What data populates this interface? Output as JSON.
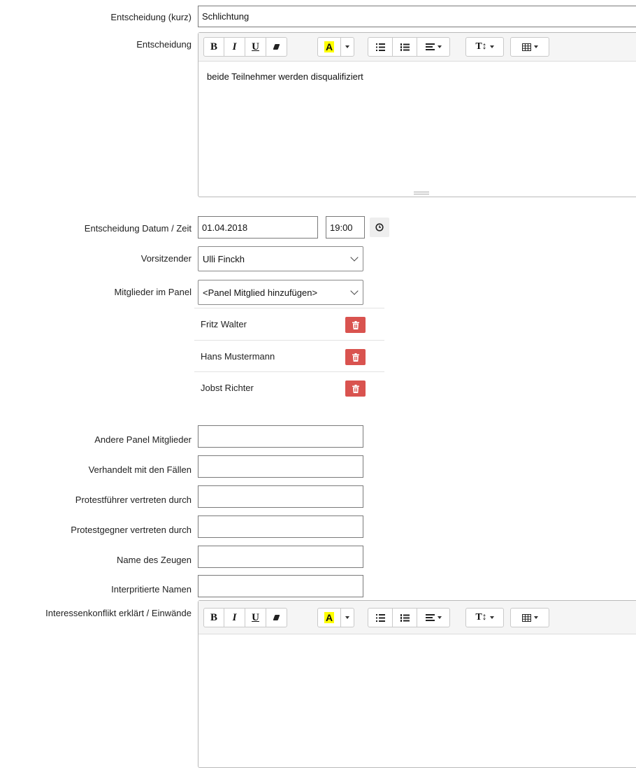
{
  "decision_short": {
    "label": "Entscheidung (kurz)",
    "value": "Schlichtung"
  },
  "decision": {
    "label": "Entscheidung",
    "content": "beide Teilnehmer werden disqualifiziert"
  },
  "decision_datetime": {
    "label": "Entscheidung Datum / Zeit",
    "date": "01.04.2018",
    "time": "19:00"
  },
  "chairman": {
    "label": "Vorsitzender",
    "selected": "Ulli Finckh"
  },
  "panel_members": {
    "label": "Mitglieder im Panel",
    "add_placeholder": "<Panel Mitglied hinzufügen>",
    "members": [
      "Fritz Walter",
      "Hans Mustermann",
      "Jobst Richter"
    ]
  },
  "fields": {
    "other_members": "Andere Panel Mitglieder",
    "cases": "Verhandelt mit den Fällen",
    "protestor_rep": "Protestführer vertreten durch",
    "protestee_rep": "Protestgegner vertreten durch",
    "witness": "Name des Zeugen",
    "interpreted": "Interpritierte Namen"
  },
  "conflict": {
    "label": "Interessenkonflikt erklärt / Einwände"
  },
  "toolbar": {
    "bold": "B",
    "italic": "I",
    "underline": "U",
    "font_color": "A",
    "font_size": "T↕"
  },
  "colors": {
    "delete_button": "#d9534f",
    "highlight": "#ffff00"
  }
}
